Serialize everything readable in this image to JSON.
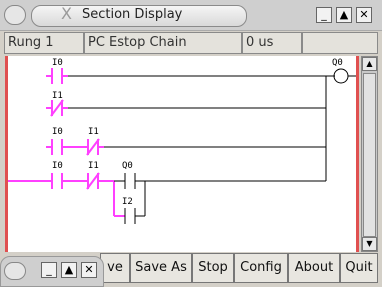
{
  "window": {
    "title": "Section Display",
    "close_glyph": "X",
    "buttons": [
      "_",
      "▲",
      "✕"
    ]
  },
  "status": {
    "rung": "Rung 1",
    "section": "PC Estop Chain",
    "time": "0 us"
  },
  "ladder": {
    "labels": [
      "I0",
      "I1",
      "I0",
      "I1",
      "I0",
      "I1",
      "Q0",
      "I2",
      "Q0"
    ],
    "colors": {
      "energized": "#ff40ff",
      "idle": "#000000",
      "rail": "#e05050"
    }
  },
  "toolbar": {
    "buttons": [
      "ve",
      "Save As",
      "Stop",
      "Config",
      "About",
      "Quit"
    ]
  },
  "mini_window": {
    "buttons": [
      "_",
      "▲",
      "✕"
    ]
  }
}
